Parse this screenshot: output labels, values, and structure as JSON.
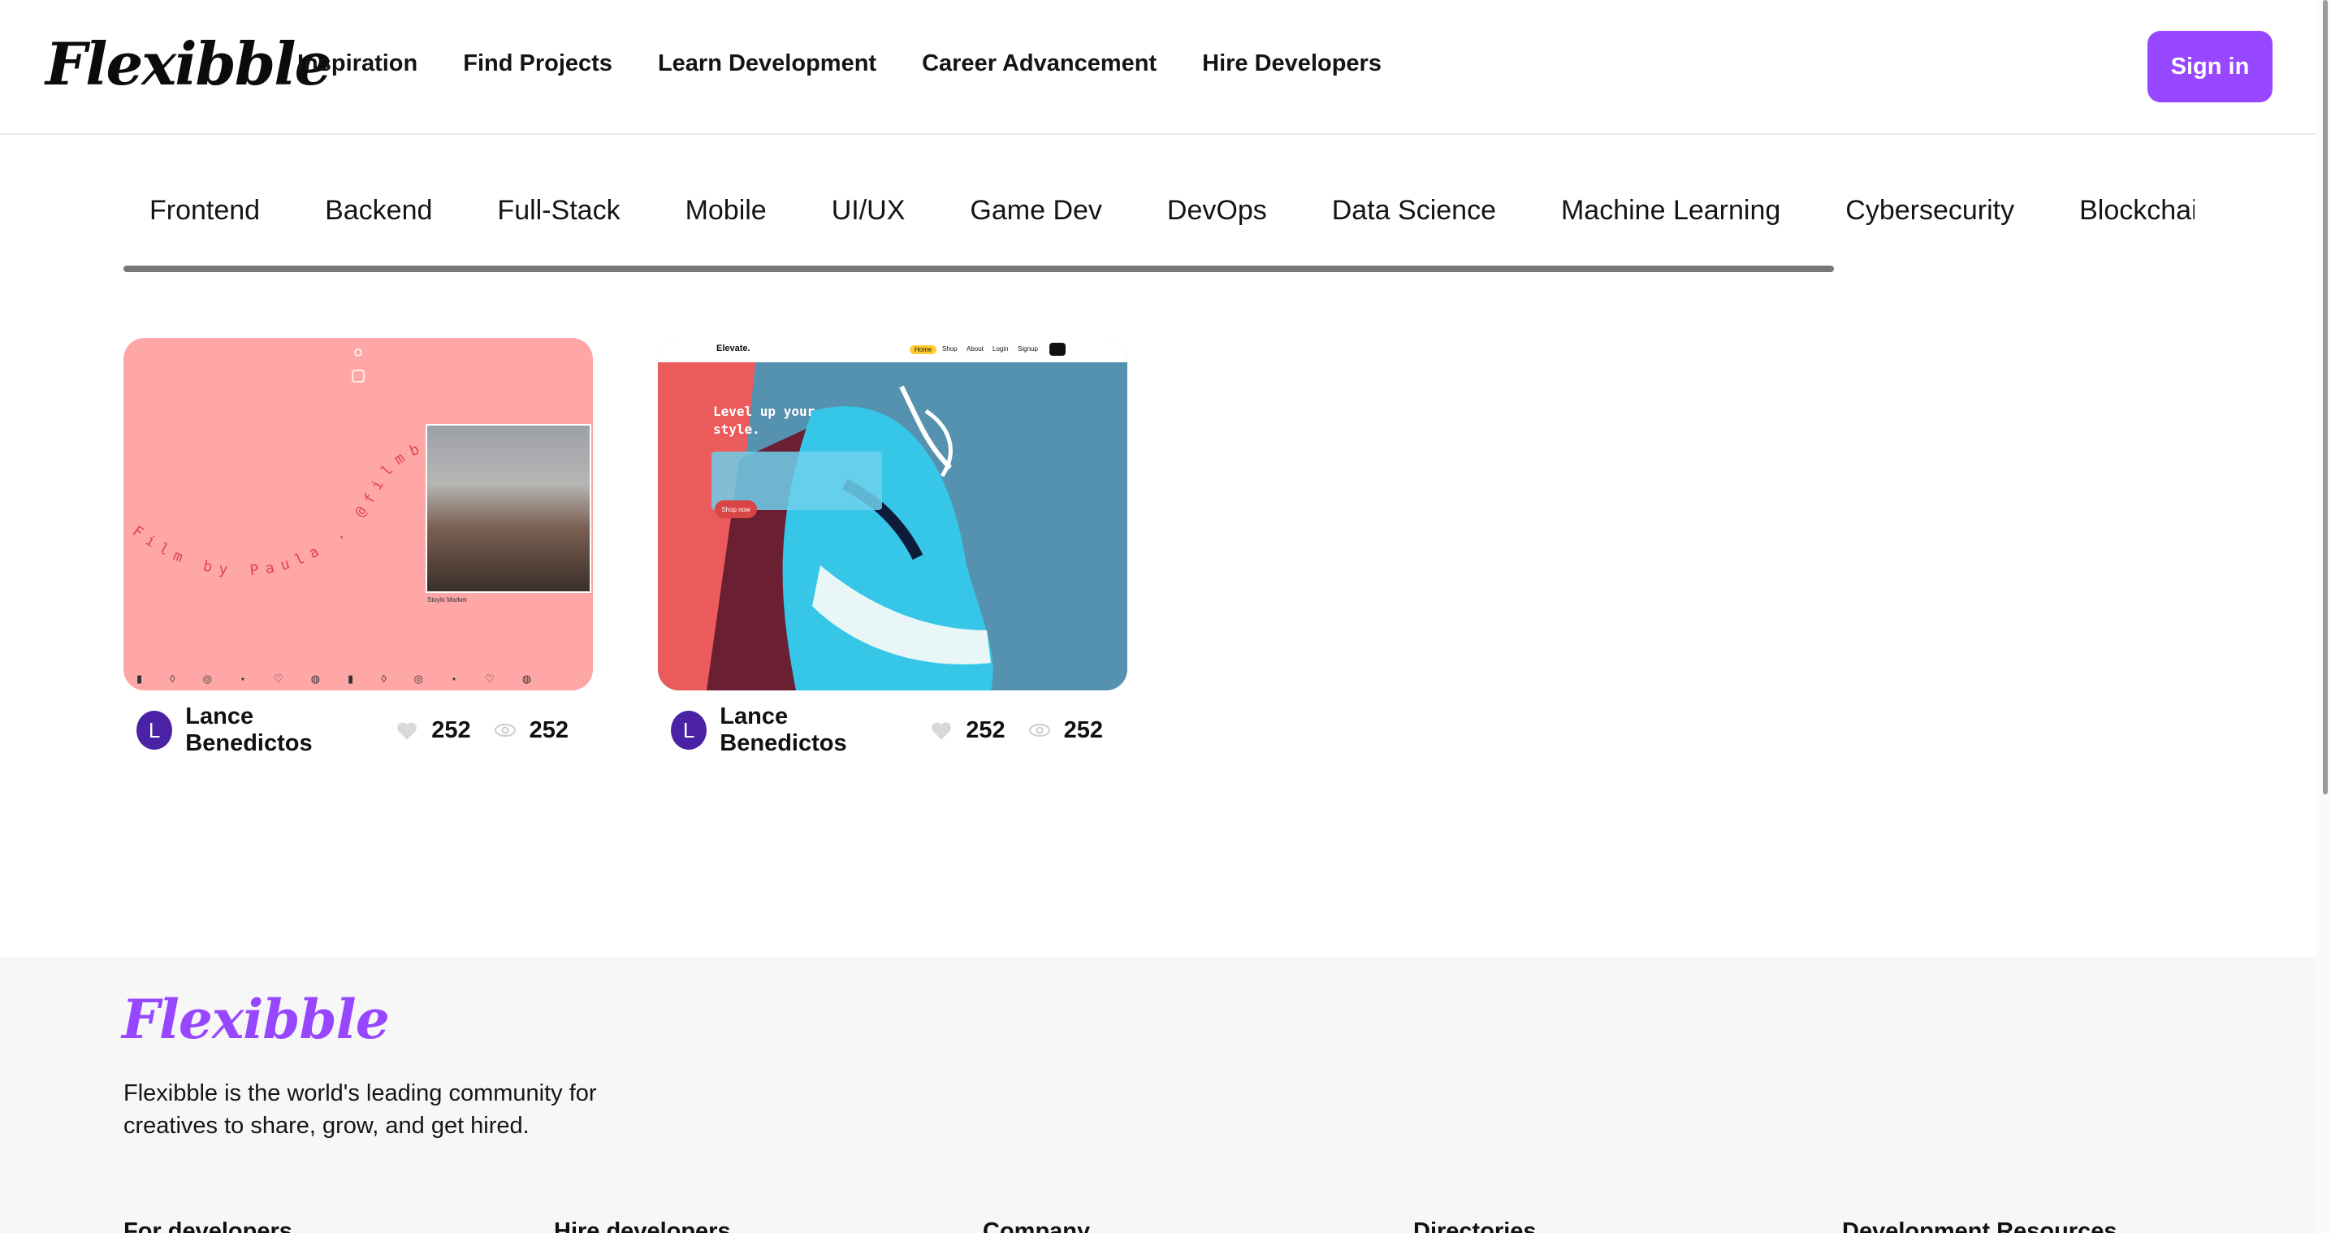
{
  "nav": {
    "logo": "Flexibble",
    "links": [
      "Inspiration",
      "Find Projects",
      "Learn Development",
      "Career Advancement",
      "Hire Developers"
    ],
    "signin": "Sign in"
  },
  "categories": [
    "Frontend",
    "Backend",
    "Full-Stack",
    "Mobile",
    "UI/UX",
    "Game Dev",
    "DevOps",
    "Data Science",
    "Machine Learning",
    "Cybersecurity",
    "Blockchair"
  ],
  "projects": [
    {
      "author": "Lance Benedictos",
      "avatar_letter": "L",
      "likes": "252",
      "views": "252",
      "thumb_text": "Film by Paula . @filmbypaula . Tor",
      "thumb_caption": "Stoyki Market"
    },
    {
      "author": "Lance Benedictos",
      "avatar_letter": "L",
      "likes": "252",
      "views": "252",
      "thumb_brand": "Elevate.",
      "thumb_nav": [
        "Home",
        "Shop",
        "About",
        "Login",
        "Signup"
      ],
      "thumb_heading_1": "Level up your",
      "thumb_heading_2": "style.",
      "thumb_button": "Shop now"
    }
  ],
  "footer": {
    "logo": "Flexibble",
    "tagline": "Flexibble is the world's leading community for creatives to share, grow, and get hired.",
    "columns": [
      "For developers",
      "Hire developers",
      "Company",
      "Directories",
      "Development Resources"
    ]
  },
  "colors": {
    "accent": "#9747ff",
    "avatar": "#4b22a6",
    "thumb1_bg": "#ffa6a6",
    "thumb2_bg": "#5592b0"
  }
}
